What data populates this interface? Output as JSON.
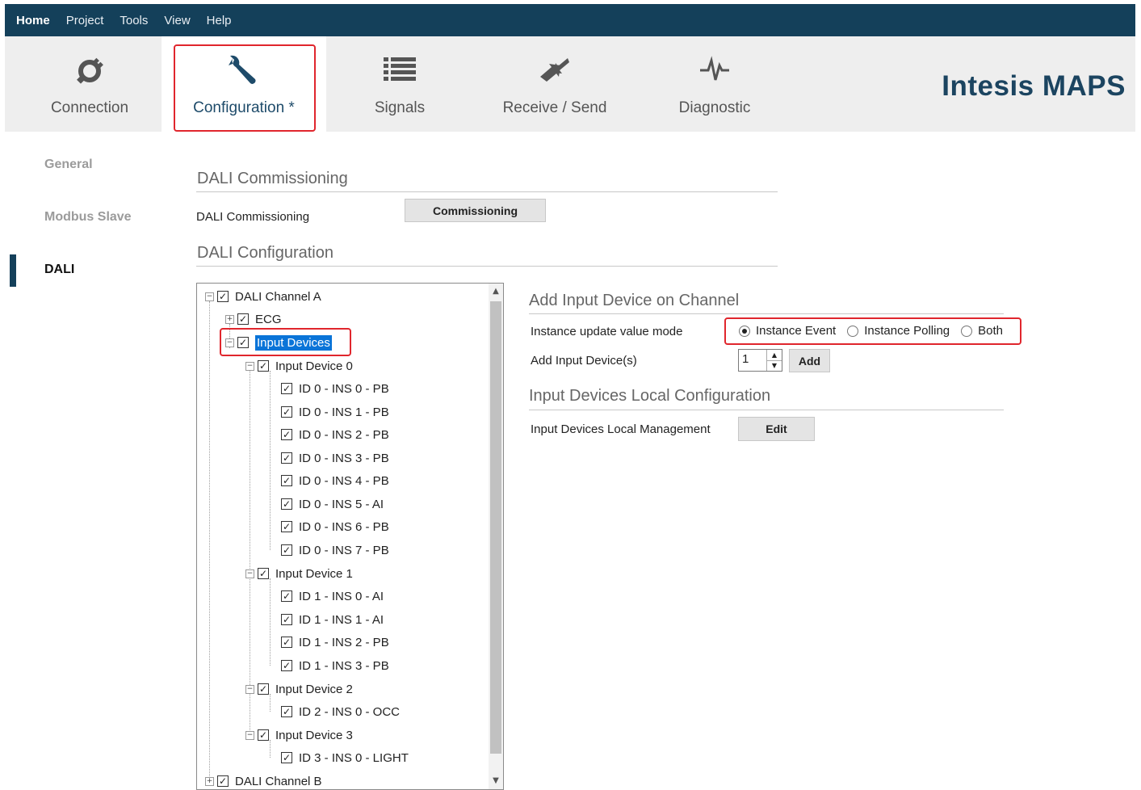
{
  "menu": {
    "items": [
      {
        "label": "Home",
        "active": true
      },
      {
        "label": "Project"
      },
      {
        "label": "Tools"
      },
      {
        "label": "View"
      },
      {
        "label": "Help"
      }
    ]
  },
  "toolbar": {
    "connection": "Connection",
    "configuration": "Configuration *",
    "signals": "Signals",
    "receive_send": "Receive / Send",
    "diagnostic": "Diagnostic"
  },
  "brand": "Intesis MAPS",
  "sidebar": {
    "general": "General",
    "modbus": "Modbus Slave",
    "dali": "DALI"
  },
  "commissioning": {
    "section_title": "DALI Commissioning",
    "row_label": "DALI Commissioning",
    "button": "Commissioning"
  },
  "configuration": {
    "section_title": "DALI Configuration"
  },
  "tree": {
    "channel_a": "DALI Channel A",
    "ecg": "ECG",
    "input_devices": "Input Devices",
    "device0": "Input Device 0",
    "d0": [
      "ID 0 - INS 0 - PB",
      "ID 0 - INS 1 - PB",
      "ID 0 - INS 2 - PB",
      "ID 0 - INS 3 - PB",
      "ID 0 - INS 4 - PB",
      "ID 0 - INS 5 - AI",
      "ID 0 - INS 6 - PB",
      "ID 0 - INS 7 - PB"
    ],
    "device1": "Input Device 1",
    "d1": [
      "ID 1 - INS 0 - AI",
      "ID 1 - INS 1 - AI",
      "ID 1 - INS 2 - PB",
      "ID 1 - INS 3 - PB"
    ],
    "device2": "Input Device 2",
    "d2": [
      "ID 2 - INS 0 - OCC"
    ],
    "device3": "Input Device 3",
    "d3": [
      "ID 3 - INS 0 - LIGHT"
    ],
    "channel_b": "DALI Channel B"
  },
  "add_input": {
    "section_title": "Add Input Device on Channel",
    "mode_label": "Instance update value mode",
    "modes": [
      "Instance Event",
      "Instance Polling",
      "Both"
    ],
    "selected_mode": "Instance Event",
    "add_label": "Add Input Device(s)",
    "quantity": "1",
    "add_button": "Add"
  },
  "local_config": {
    "section_title": "Input Devices Local Configuration",
    "row_label": "Input Devices Local Management",
    "button": "Edit"
  },
  "colors": {
    "menubar": "#14405a",
    "highlight": "#e0262d",
    "selection": "#0a74d8",
    "brand": "#1b4460"
  }
}
